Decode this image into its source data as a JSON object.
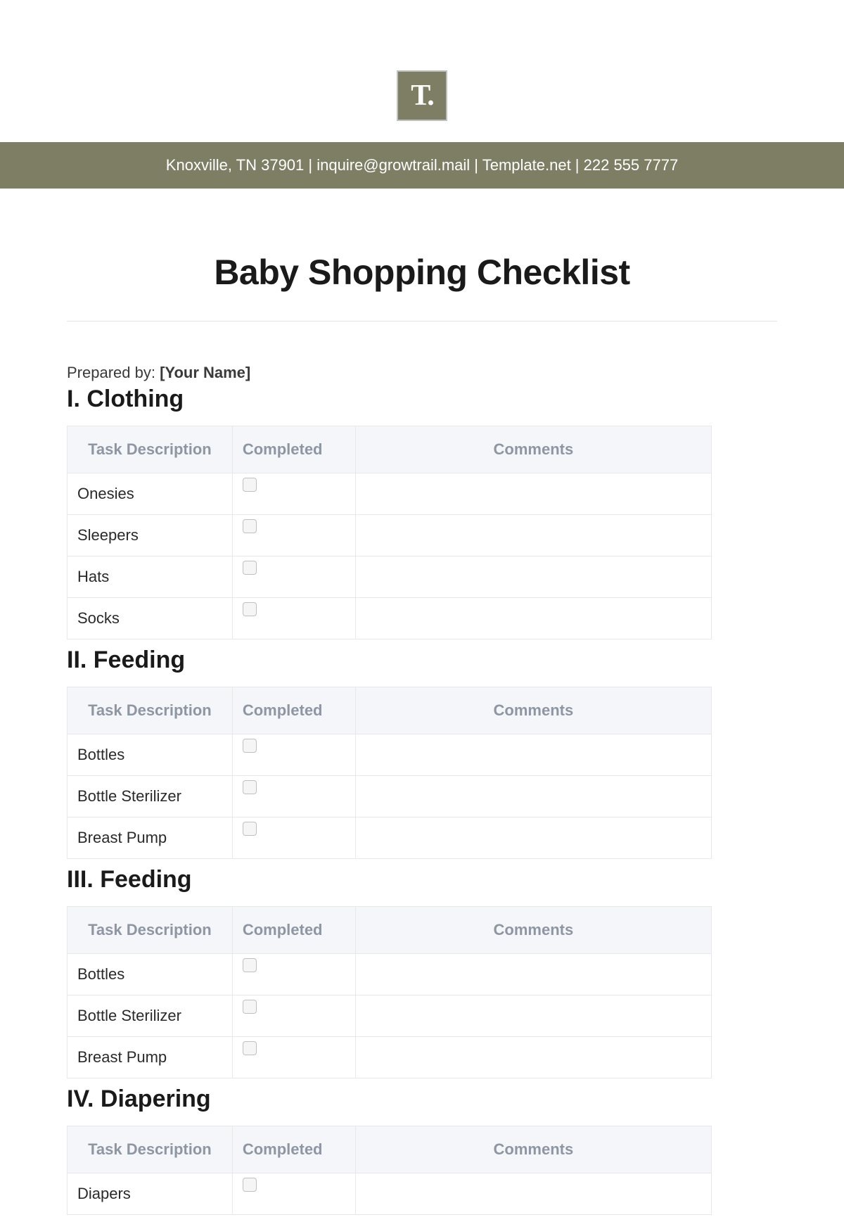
{
  "logo": {
    "text": "T."
  },
  "header_banner": "Knoxville, TN 37901 | inquire@growtrail.mail | Template.net | 222 555 7777",
  "page_title": "Baby Shopping Checklist",
  "prepared_by_label": "Prepared by: ",
  "prepared_by_name": "[Your Name]",
  "columns": {
    "task": "Task Description",
    "completed": "Completed",
    "comments": "Comments"
  },
  "sections": [
    {
      "title": "I. Clothing",
      "rows": [
        {
          "task": "Onesies",
          "completed": false,
          "comments": ""
        },
        {
          "task": "Sleepers",
          "completed": false,
          "comments": ""
        },
        {
          "task": "Hats",
          "completed": false,
          "comments": ""
        },
        {
          "task": "Socks",
          "completed": false,
          "comments": ""
        }
      ]
    },
    {
      "title": "II. Feeding",
      "rows": [
        {
          "task": "Bottles",
          "completed": false,
          "comments": ""
        },
        {
          "task": "Bottle Sterilizer",
          "completed": false,
          "comments": ""
        },
        {
          "task": "Breast Pump",
          "completed": false,
          "comments": ""
        }
      ]
    },
    {
      "title": "III. Feeding",
      "rows": [
        {
          "task": "Bottles",
          "completed": false,
          "comments": ""
        },
        {
          "task": "Bottle Sterilizer",
          "completed": false,
          "comments": ""
        },
        {
          "task": "Breast Pump",
          "completed": false,
          "comments": ""
        }
      ]
    },
    {
      "title": "IV. Diapering",
      "rows": [
        {
          "task": "Diapers",
          "completed": false,
          "comments": ""
        }
      ]
    }
  ]
}
